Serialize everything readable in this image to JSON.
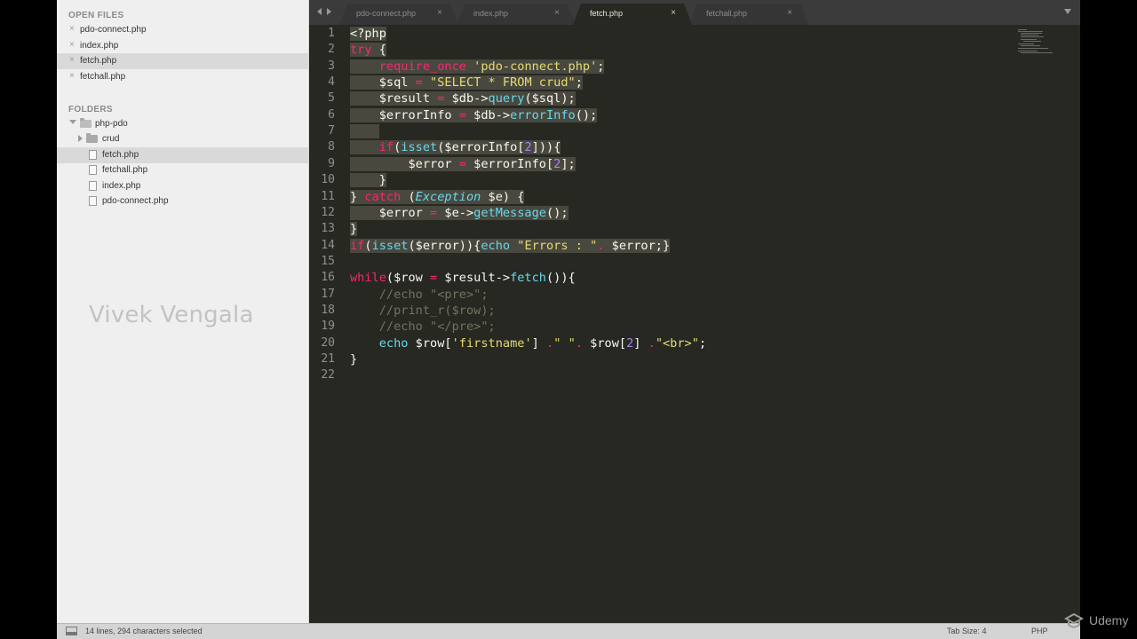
{
  "sidebar": {
    "open_files_heading": "OPEN FILES",
    "open_files": [
      {
        "label": "pdo-connect.php",
        "selected": false
      },
      {
        "label": "index.php",
        "selected": false
      },
      {
        "label": "fetch.php",
        "selected": true
      },
      {
        "label": "fetchall.php",
        "selected": false
      }
    ],
    "folders_heading": "FOLDERS",
    "root_folder": "php-pdo",
    "subfolder": "crud",
    "files": [
      {
        "label": "fetch.php",
        "selected": true
      },
      {
        "label": "fetchall.php",
        "selected": false
      },
      {
        "label": "index.php",
        "selected": false
      },
      {
        "label": "pdo-connect.php",
        "selected": false
      }
    ]
  },
  "watermark": "Vivek Vengala",
  "tabs": [
    {
      "label": "pdo-connect.php",
      "active": false
    },
    {
      "label": "index.php",
      "active": false
    },
    {
      "label": "fetch.php",
      "active": true
    },
    {
      "label": "fetchall.php",
      "active": false
    }
  ],
  "editor": {
    "lines": [
      {
        "n": "1",
        "selected": true,
        "tokens": [
          [
            "txt",
            "<?php"
          ]
        ]
      },
      {
        "n": "2",
        "selected": true,
        "tokens": [
          [
            "kw",
            "try"
          ],
          [
            "txt",
            " {"
          ]
        ]
      },
      {
        "n": "3",
        "selected": true,
        "tokens": [
          [
            "txt",
            "    "
          ],
          [
            "kw",
            "require_once"
          ],
          [
            "txt",
            " "
          ],
          [
            "str",
            "'pdo-connect.php'"
          ],
          [
            "txt",
            ";"
          ]
        ]
      },
      {
        "n": "4",
        "selected": true,
        "tokens": [
          [
            "txt",
            "    $sql "
          ],
          [
            "kw",
            "="
          ],
          [
            "txt",
            " "
          ],
          [
            "str",
            "\"SELECT * FROM crud\""
          ],
          [
            "txt",
            ";"
          ]
        ]
      },
      {
        "n": "5",
        "selected": true,
        "tokens": [
          [
            "txt",
            "    $result "
          ],
          [
            "kw",
            "="
          ],
          [
            "txt",
            " $db->"
          ],
          [
            "fn",
            "query"
          ],
          [
            "txt",
            "($sql);"
          ]
        ]
      },
      {
        "n": "6",
        "selected": true,
        "tokens": [
          [
            "txt",
            "    $errorInfo "
          ],
          [
            "kw",
            "="
          ],
          [
            "txt",
            " $db->"
          ],
          [
            "fn",
            "errorInfo"
          ],
          [
            "txt",
            "();"
          ]
        ]
      },
      {
        "n": "7",
        "selected": true,
        "tokens": [
          [
            "txt",
            "    "
          ]
        ]
      },
      {
        "n": "8",
        "selected": true,
        "tokens": [
          [
            "txt",
            "    "
          ],
          [
            "kw",
            "if"
          ],
          [
            "txt",
            "("
          ],
          [
            "fn",
            "isset"
          ],
          [
            "txt",
            "($errorInfo["
          ],
          [
            "num",
            "2"
          ],
          [
            "txt",
            "])){"
          ]
        ]
      },
      {
        "n": "9",
        "selected": true,
        "tokens": [
          [
            "txt",
            "        $error "
          ],
          [
            "kw",
            "="
          ],
          [
            "txt",
            " $errorInfo["
          ],
          [
            "num",
            "2"
          ],
          [
            "txt",
            "];"
          ]
        ]
      },
      {
        "n": "10",
        "selected": true,
        "tokens": [
          [
            "txt",
            "    }"
          ]
        ]
      },
      {
        "n": "11",
        "selected": true,
        "tokens": [
          [
            "txt",
            "} "
          ],
          [
            "kw",
            "catch"
          ],
          [
            "txt",
            " ("
          ],
          [
            "it",
            "Exception"
          ],
          [
            "txt",
            " $e) {"
          ]
        ]
      },
      {
        "n": "12",
        "selected": true,
        "tokens": [
          [
            "txt",
            "    $error "
          ],
          [
            "kw",
            "="
          ],
          [
            "txt",
            " $e->"
          ],
          [
            "fn",
            "getMessage"
          ],
          [
            "txt",
            "();"
          ]
        ]
      },
      {
        "n": "13",
        "selected": true,
        "tokens": [
          [
            "txt",
            "}"
          ]
        ]
      },
      {
        "n": "14",
        "selected": true,
        "tokens": [
          [
            "kw",
            "if"
          ],
          [
            "txt",
            "("
          ],
          [
            "fn",
            "isset"
          ],
          [
            "txt",
            "($error)){"
          ],
          [
            "fn",
            "echo"
          ],
          [
            "txt",
            " "
          ],
          [
            "str",
            "\"Errors : \""
          ],
          [
            "kw",
            "."
          ],
          [
            "txt",
            " $error;}"
          ]
        ]
      },
      {
        "n": "15",
        "selected": false,
        "tokens": []
      },
      {
        "n": "16",
        "selected": false,
        "tokens": [
          [
            "kw",
            "while"
          ],
          [
            "txt",
            "($row "
          ],
          [
            "kw",
            "="
          ],
          [
            "txt",
            " $result->"
          ],
          [
            "fn",
            "fetch"
          ],
          [
            "txt",
            "()){"
          ]
        ]
      },
      {
        "n": "17",
        "selected": false,
        "tokens": [
          [
            "cm",
            "    //echo \"<pre>\";"
          ]
        ]
      },
      {
        "n": "18",
        "selected": false,
        "tokens": [
          [
            "cm",
            "    //print_r($row);"
          ]
        ]
      },
      {
        "n": "19",
        "selected": false,
        "tokens": [
          [
            "cm",
            "    //echo \"</pre>\";"
          ]
        ]
      },
      {
        "n": "20",
        "selected": false,
        "tokens": [
          [
            "txt",
            "    "
          ],
          [
            "fn",
            "echo"
          ],
          [
            "txt",
            " $row["
          ],
          [
            "str",
            "'firstname'"
          ],
          [
            "txt",
            "] "
          ],
          [
            "kw",
            "."
          ],
          [
            "str",
            "\" \""
          ],
          [
            "kw",
            "."
          ],
          [
            "txt",
            " $row["
          ],
          [
            "num",
            "2"
          ],
          [
            "txt",
            "] "
          ],
          [
            "kw",
            "."
          ],
          [
            "str",
            "\"<br>\""
          ],
          [
            "txt",
            ";"
          ]
        ]
      },
      {
        "n": "21",
        "selected": false,
        "tokens": [
          [
            "txt",
            "}"
          ]
        ]
      },
      {
        "n": "22",
        "selected": false,
        "tokens": []
      }
    ]
  },
  "statusbar": {
    "selection": "14 lines, 294 characters selected",
    "tab_size": "Tab Size: 4",
    "syntax": "PHP"
  },
  "branding": {
    "logo_text": "Udemy"
  },
  "colors": {
    "editor_bg": "#272822",
    "keyword": "#f92672",
    "string": "#e6db74",
    "function": "#66d9ef",
    "number": "#ae81ff",
    "comment": "#75715e",
    "selection": "#49483e"
  }
}
